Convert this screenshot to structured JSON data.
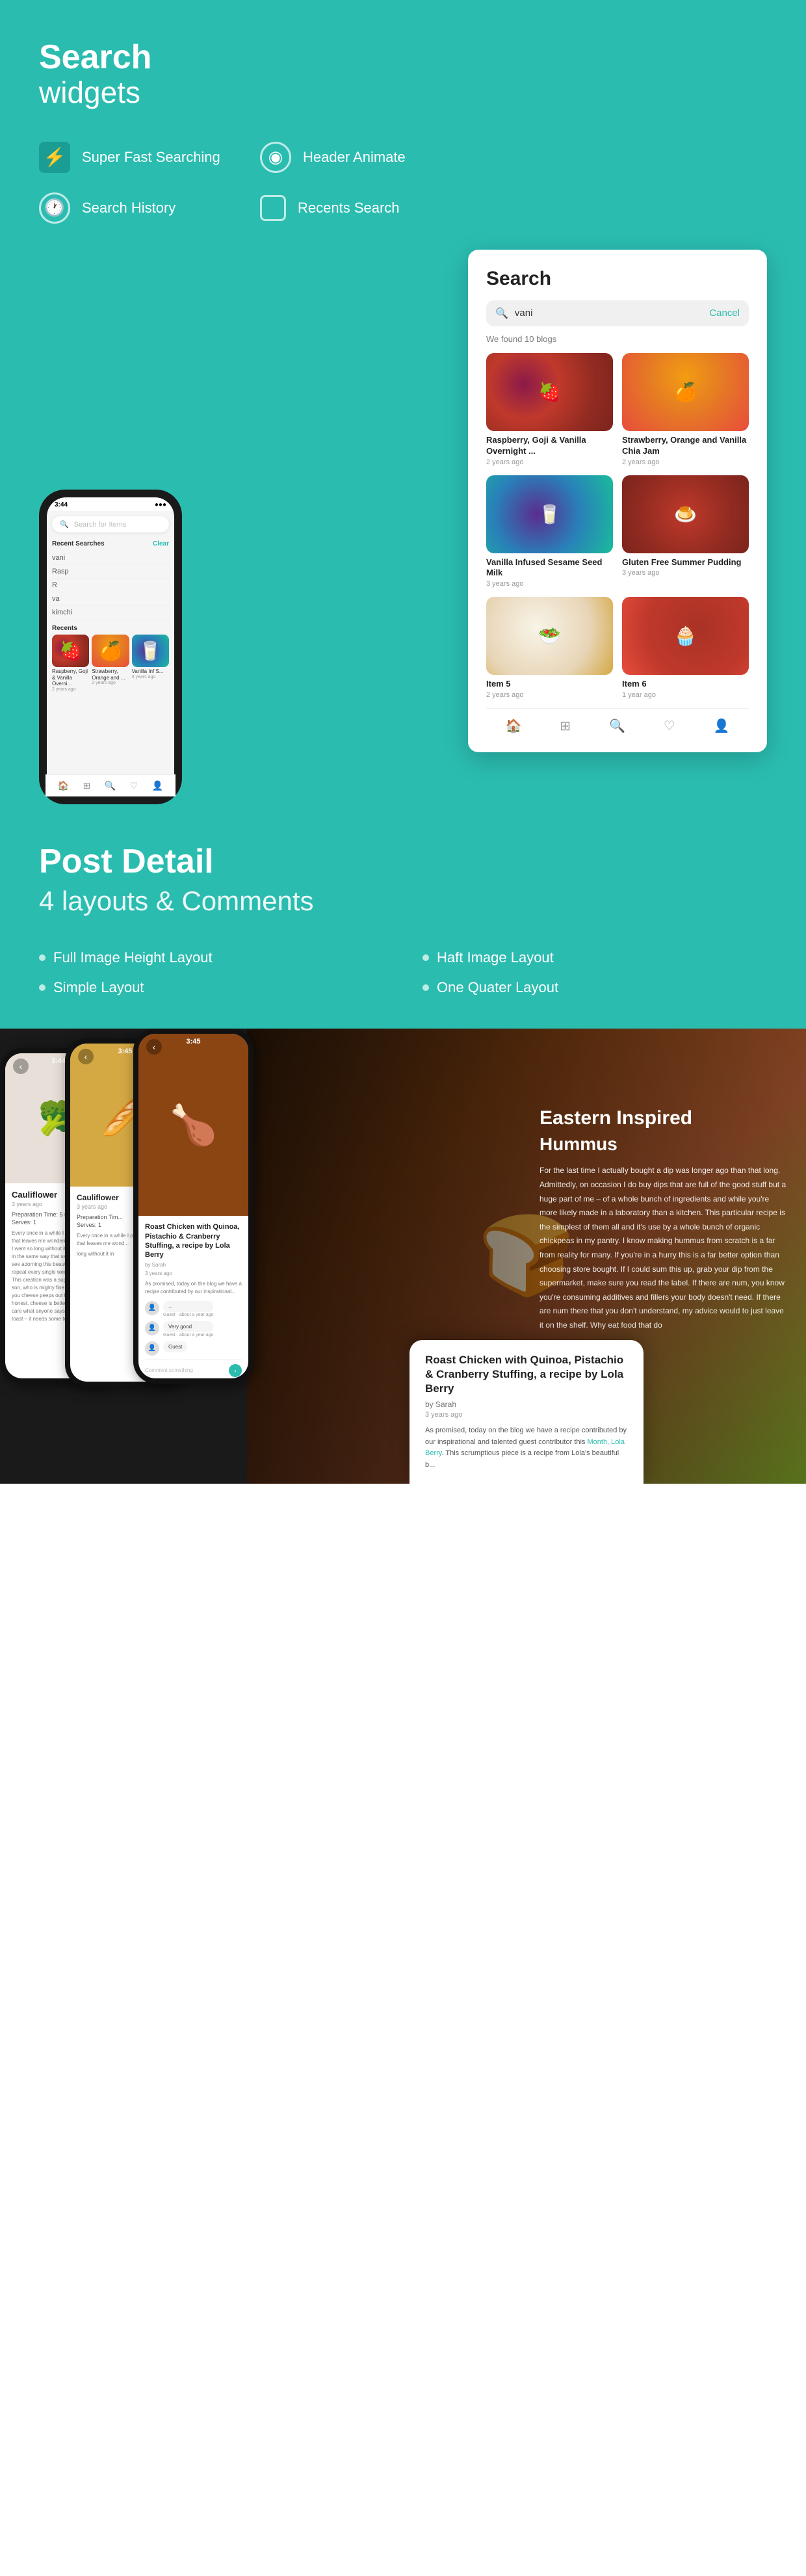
{
  "hero": {
    "title": "Search",
    "title_line2": "widgets",
    "features": [
      {
        "id": "fast",
        "icon": "⚡",
        "label": "Super Fast Searching",
        "icon_type": "bolt"
      },
      {
        "id": "header",
        "icon": "◉",
        "label": "Header Animate",
        "icon_type": "circle"
      },
      {
        "id": "history",
        "icon": "🕐",
        "label": "Search History",
        "icon_type": "circle"
      },
      {
        "id": "recents",
        "icon": "▢",
        "label": "Recents Search",
        "icon_type": "square"
      }
    ]
  },
  "phone_search": {
    "search_placeholder": "Search for Items",
    "recent_label": "Recent Searches",
    "clear_label": "Clear",
    "items": [
      "vani",
      "Rasp",
      "R",
      "va",
      "kimchi"
    ],
    "recents_label": "Recents",
    "thumb_items": [
      {
        "label": "Raspberry, Goji & Vanilla Overni...",
        "date": "2 years ago",
        "emoji": "🍓"
      },
      {
        "label": "Strawberry, Orange and ...",
        "date": "2 years ago",
        "emoji": "🍊"
      },
      {
        "label": "Vanilla Inf S...",
        "date": "3 years ago",
        "emoji": "🥛"
      }
    ]
  },
  "search_panel": {
    "title": "Search",
    "query": "vani",
    "cancel_label": "Cancel",
    "found_text": "We found 10 blogs",
    "results": [
      {
        "title": "Raspberry, Goji & Vanilla Overnight ...",
        "date": "2 years ago",
        "emoji": "🍓",
        "food_class": "css-food-1"
      },
      {
        "title": "Strawberry, Orange and Vanilla Chia Jam",
        "date": "2 years ago",
        "emoji": "🍊",
        "food_class": "css-food-2"
      },
      {
        "title": "Vanilla Infused Sesame Seed Milk",
        "date": "3 years ago",
        "emoji": "🥛",
        "food_class": "css-food-3"
      },
      {
        "title": "Gluten Free Summer Pudding",
        "date": "3 years ago",
        "emoji": "🍮",
        "food_class": "css-food-4"
      },
      {
        "title": "Item 5",
        "date": "2 years ago",
        "emoji": "🥗",
        "food_class": "css-food-5"
      },
      {
        "title": "Item 6",
        "date": "1 year ago",
        "emoji": "🧁",
        "food_class": "css-food-6"
      }
    ]
  },
  "post_detail_section": {
    "title": "Post Detail",
    "subtitle": "4 layouts & Comments",
    "layouts": [
      "Full Image Height Layout",
      "Haft Image Layout",
      "Simple Layout",
      "One Quater Layout"
    ]
  },
  "recipe_screens": {
    "screen1": {
      "time": "3:44",
      "title": "Cauliflower",
      "date": "3 years ago",
      "prep": "Preparation Time: 5 minutes",
      "serves": "Serves: 1",
      "body": "Every once in a while I plate up a recipe that leaves me wondering how on earth I went so long without it in my life. Much in the same way that second egg you see adorning this beauty is now on repeat every single week, with cheese. This creation was a suggestion by my son, who is mighty fine on at all. To all of you cheese peeps out there, let's be honest, cheese is better on toast. I don't care what anyone says. Egg yolk needs toast – it needs some toast!"
    },
    "screen2": {
      "time": "3:45",
      "title": "Cauliflower"
    },
    "screen3": {
      "time": "3:45"
    },
    "eastern": {
      "title": "Eastern Inspired",
      "subtitle": "Hummus",
      "body": "For the last time I actually bought a dip was longer ago than that long. Admittedly, on occasion I do buy dips that are full of the good stuff but a huge part of me – of a whole bunch of ingredients and while you're more likely made in a laboratory than a kitchen. This particular recipe is the simplest of them all and it's use by a whole bunch of organic chickpeas in my pantry. I know making hummus from scratch is a far from reality for many. If you're in a hurry this is a far better option than choosing store bought. If I could sum this up, grab your dip from the supermarket, make sure you read the label. If there are num, you know you're consuming additives and fillers your body doesn't need. If there are num there that you don't understand, my advice would to just leave it on the shelf. Why eat food that do"
    }
  },
  "post_card": {
    "title": "Roast Chicken with Quinoa, Pistachio & Cranberry Stuffing, a recipe by Lola Berry",
    "author": "by Sarah",
    "date": "3 years ago",
    "body": "As promised, today on the blog we have a recipe contributed by our inspirational and talented guest contributor this Month, Lola Berry. This scrumptious piece is a recipe from Lola's beautiful b...",
    "link_text": "Month, Lola Berry"
  },
  "comments": [
    {
      "avatar": "👤",
      "name": "Guest",
      "text": "...",
      "time": "about a year ago"
    },
    {
      "avatar": "👤",
      "name": "Guest",
      "text": "Very good",
      "time": "about a year ago"
    },
    {
      "avatar": "👤",
      "name": "Guest",
      "text": "",
      "time": ""
    }
  ],
  "comment_input": {
    "placeholder": "Comment something"
  },
  "nav_items": [
    {
      "icon": "🏠",
      "active": false
    },
    {
      "icon": "⊞",
      "active": false
    },
    {
      "icon": "🔍",
      "active": true
    },
    {
      "icon": "♡",
      "active": false
    },
    {
      "icon": "👤",
      "active": false
    }
  ],
  "colors": {
    "teal": "#2bbcb0",
    "dark": "#1a1a1a",
    "light_gray": "#f5f5f5"
  }
}
